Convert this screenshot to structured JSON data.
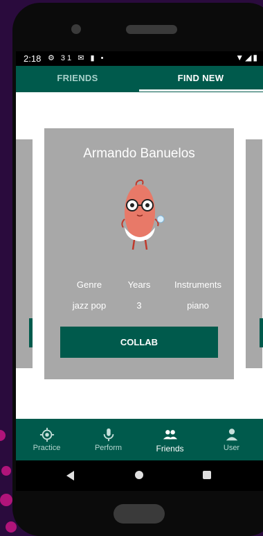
{
  "status_bar": {
    "time": "2:18",
    "left_icons": "⚙ 31 ✉ ▮ •",
    "right_icons": "▼◢▮"
  },
  "tabs": [
    {
      "label": "FRIENDS",
      "active": false
    },
    {
      "label": "FIND NEW",
      "active": true
    }
  ],
  "card": {
    "name": "Armando Banuelos",
    "labels": {
      "genre": "Genre",
      "years": "Years",
      "instruments": "Instruments"
    },
    "values": {
      "genre": "jazz pop",
      "years": "3",
      "instruments": "piano"
    },
    "button": "COLLAB"
  },
  "bottom_nav": [
    {
      "label": "Practice",
      "icon": "target-icon",
      "active": false
    },
    {
      "label": "Perform",
      "icon": "microphone-icon",
      "active": false
    },
    {
      "label": "Friends",
      "icon": "people-icon",
      "active": true
    },
    {
      "label": "User",
      "icon": "person-icon",
      "active": false
    }
  ],
  "colors": {
    "primary": "#005a4c",
    "card_bg": "#a8a8a8",
    "background": "#2a0b3d",
    "accent_dots": "#b0147a"
  }
}
